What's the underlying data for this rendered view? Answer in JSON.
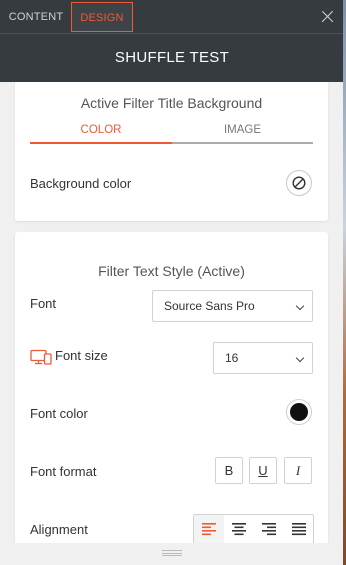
{
  "header": {
    "tabs": [
      {
        "label": "CONTENT",
        "active": false
      },
      {
        "label": "DESIGN",
        "active": true
      }
    ],
    "title": "SHUFFLE TEST"
  },
  "section_title_background": {
    "heading": "Active Filter Title Background",
    "tabs": [
      {
        "label": "COLOR",
        "active": true
      },
      {
        "label": "IMAGE",
        "active": false
      }
    ],
    "background_color_label": "Background color",
    "background_color_value": "none"
  },
  "section_text_style": {
    "heading": "Filter Text Style (Active)",
    "font_label": "Font",
    "font_value": "Source Sans Pro",
    "font_size_label": "Font size",
    "font_size_value": "16",
    "font_color_label": "Font color",
    "font_color_value": "#111111",
    "font_format_label": "Font format",
    "format_buttons": [
      "B",
      "U",
      "I"
    ],
    "alignment_label": "Alignment",
    "alignment_options": [
      "left",
      "center",
      "right",
      "justify"
    ],
    "alignment_selected": "left"
  },
  "colors": {
    "accent": "#ee5a36",
    "header_bg": "#353b3e",
    "panel_bg": "#f0f0f0"
  }
}
